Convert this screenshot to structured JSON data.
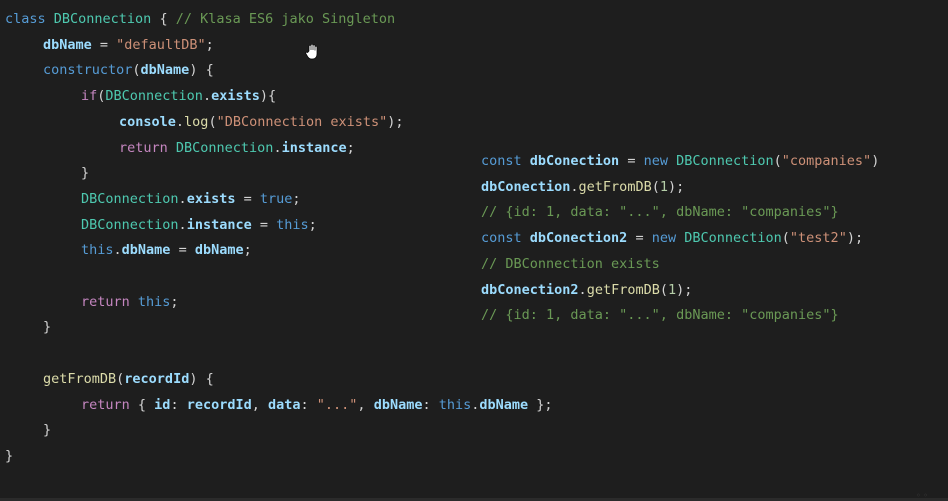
{
  "code_left": [
    {
      "indent": 0,
      "tokens": [
        [
          "class ",
          "kw"
        ],
        [
          "DBConnection",
          "cls"
        ],
        [
          " { ",
          "plain"
        ],
        [
          "// Klasa ES6 jako Singleton",
          "com"
        ]
      ]
    },
    {
      "indent": 1,
      "tokens": [
        [
          "dbName",
          "var"
        ],
        [
          " = ",
          "plain"
        ],
        [
          "\"defaultDB\"",
          "str"
        ],
        [
          ";",
          "plain"
        ]
      ]
    },
    {
      "indent": 1,
      "tokens": [
        [
          "constructor",
          "kw"
        ],
        [
          "(",
          "plain"
        ],
        [
          "dbName",
          "var"
        ],
        [
          ") {",
          "plain"
        ]
      ]
    },
    {
      "indent": 2,
      "tokens": [
        [
          "if",
          "kwc"
        ],
        [
          "(",
          "plain"
        ],
        [
          "DBConnection",
          "cls"
        ],
        [
          ".",
          "plain"
        ],
        [
          "exists",
          "var"
        ],
        [
          "){",
          "plain"
        ]
      ]
    },
    {
      "indent": 3,
      "tokens": [
        [
          "console",
          "var"
        ],
        [
          ".",
          "plain"
        ],
        [
          "log",
          "fn"
        ],
        [
          "(",
          "plain"
        ],
        [
          "\"DBConnection exists\"",
          "str"
        ],
        [
          ");",
          "plain"
        ]
      ]
    },
    {
      "indent": 3,
      "tokens": [
        [
          "return ",
          "kwc"
        ],
        [
          "DBConnection",
          "cls"
        ],
        [
          ".",
          "plain"
        ],
        [
          "instance",
          "var"
        ],
        [
          ";",
          "plain"
        ]
      ]
    },
    {
      "indent": 2,
      "tokens": [
        [
          "}",
          "plain"
        ]
      ]
    },
    {
      "indent": 2,
      "tokens": [
        [
          "DBConnection",
          "cls"
        ],
        [
          ".",
          "plain"
        ],
        [
          "exists",
          "var"
        ],
        [
          " = ",
          "plain"
        ],
        [
          "true",
          "kw"
        ],
        [
          ";",
          "plain"
        ]
      ]
    },
    {
      "indent": 2,
      "tokens": [
        [
          "DBConnection",
          "cls"
        ],
        [
          ".",
          "plain"
        ],
        [
          "instance",
          "var"
        ],
        [
          " = ",
          "plain"
        ],
        [
          "this",
          "kw"
        ],
        [
          ";",
          "plain"
        ]
      ]
    },
    {
      "indent": 2,
      "tokens": [
        [
          "this",
          "kw"
        ],
        [
          ".",
          "plain"
        ],
        [
          "dbName",
          "var"
        ],
        [
          " = ",
          "plain"
        ],
        [
          "dbName",
          "var"
        ],
        [
          ";",
          "plain"
        ]
      ]
    },
    {
      "indent": 0,
      "tokens": []
    },
    {
      "indent": 2,
      "tokens": [
        [
          "return ",
          "kwc"
        ],
        [
          "this",
          "kw"
        ],
        [
          ";",
          "plain"
        ]
      ]
    },
    {
      "indent": 1,
      "tokens": [
        [
          "}",
          "plain"
        ]
      ]
    },
    {
      "indent": 0,
      "tokens": []
    },
    {
      "indent": 1,
      "tokens": [
        [
          "getFromDB",
          "fn"
        ],
        [
          "(",
          "plain"
        ],
        [
          "recordId",
          "var"
        ],
        [
          ") {",
          "plain"
        ]
      ]
    },
    {
      "indent": 2,
      "tokens": [
        [
          "return ",
          "kwc"
        ],
        [
          "{ ",
          "plain"
        ],
        [
          "id",
          "var"
        ],
        [
          ": ",
          "plain"
        ],
        [
          "recordId",
          "var"
        ],
        [
          ", ",
          "plain"
        ],
        [
          "data",
          "var"
        ],
        [
          ": ",
          "plain"
        ],
        [
          "\"...\"",
          "str"
        ],
        [
          ", ",
          "plain"
        ],
        [
          "dbName",
          "var"
        ],
        [
          ": ",
          "plain"
        ],
        [
          "this",
          "kw"
        ],
        [
          ".",
          "plain"
        ],
        [
          "dbName",
          "var"
        ],
        [
          " };",
          "plain"
        ]
      ]
    },
    {
      "indent": 1,
      "tokens": [
        [
          "}",
          "plain"
        ]
      ]
    },
    {
      "indent": 0,
      "tokens": [
        [
          "}",
          "plain"
        ]
      ]
    }
  ],
  "code_right": [
    {
      "tokens": [
        [
          "const ",
          "kw"
        ],
        [
          "dbConection",
          "var"
        ],
        [
          " = ",
          "plain"
        ],
        [
          "new ",
          "kw"
        ],
        [
          "DBConnection",
          "cls"
        ],
        [
          "(",
          "plain"
        ],
        [
          "\"companies\"",
          "str"
        ],
        [
          ")",
          "plain"
        ]
      ]
    },
    {
      "tokens": [
        [
          "dbConection",
          "var"
        ],
        [
          ".",
          "plain"
        ],
        [
          "getFromDB",
          "fn"
        ],
        [
          "(",
          "plain"
        ],
        [
          "1",
          "num"
        ],
        [
          ");",
          "plain"
        ]
      ]
    },
    {
      "tokens": [
        [
          "// {id: 1, data: \"...\", dbName: \"companies\"}",
          "com"
        ]
      ]
    },
    {
      "tokens": [
        [
          "const ",
          "kw"
        ],
        [
          "dbConection2",
          "var"
        ],
        [
          " = ",
          "plain"
        ],
        [
          "new ",
          "kw"
        ],
        [
          "DBConnection",
          "cls"
        ],
        [
          "(",
          "plain"
        ],
        [
          "\"test2\"",
          "str"
        ],
        [
          ");",
          "plain"
        ]
      ]
    },
    {
      "tokens": [
        [
          "// DBConnection exists",
          "com"
        ]
      ]
    },
    {
      "tokens": [
        [
          "dbConection2",
          "var"
        ],
        [
          ".",
          "plain"
        ],
        [
          "getFromDB",
          "fn"
        ],
        [
          "(",
          "plain"
        ],
        [
          "1",
          "num"
        ],
        [
          ");",
          "plain"
        ]
      ]
    },
    {
      "tokens": [
        [
          "// {id: 1, data: \"...\", dbName: \"companies\"}",
          "com"
        ]
      ]
    }
  ],
  "colors": {
    "background": "#1e1e1e",
    "keyword": "#569cd6",
    "control": "#c586c0",
    "class": "#4ec9b0",
    "function": "#dcdcaa",
    "variable": "#9cdcfe",
    "string": "#ce9178",
    "number": "#b5cea8",
    "comment": "#6a9955",
    "text": "#d4d4d4"
  },
  "icons": {
    "cursor": "hand-pointer-icon"
  }
}
